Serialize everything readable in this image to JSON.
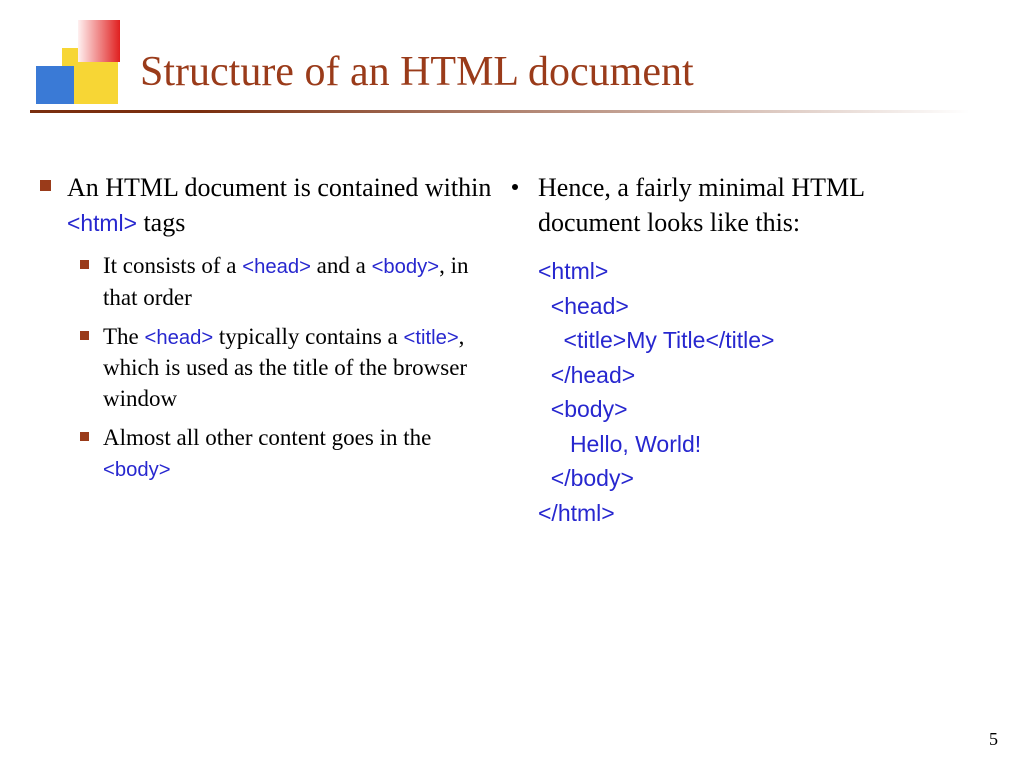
{
  "title": "Structure of an HTML document",
  "left": {
    "main": {
      "pre": "An HTML document is contained within ",
      "tag": "<html>",
      "post": " tags"
    },
    "sub1": {
      "pre": "It consists of a ",
      "t1": "<head>",
      "mid": " and a ",
      "t2": "<body>",
      "post": ", in that order"
    },
    "sub2": {
      "pre": "The ",
      "t1": "<head>",
      "mid": " typically contains a ",
      "t2": "<title>",
      "post": ", which is used as the title of the browser window"
    },
    "sub3": {
      "pre": "Almost all other content goes in the ",
      "t1": "<body>"
    }
  },
  "right": {
    "intro": "Hence, a fairly minimal HTML document looks like this:",
    "code": "<html>\n  <head>\n    <title>My Title</title>\n  </head>\n  <body>\n     Hello, World!\n  </body>\n</html>"
  },
  "page_number": "5"
}
